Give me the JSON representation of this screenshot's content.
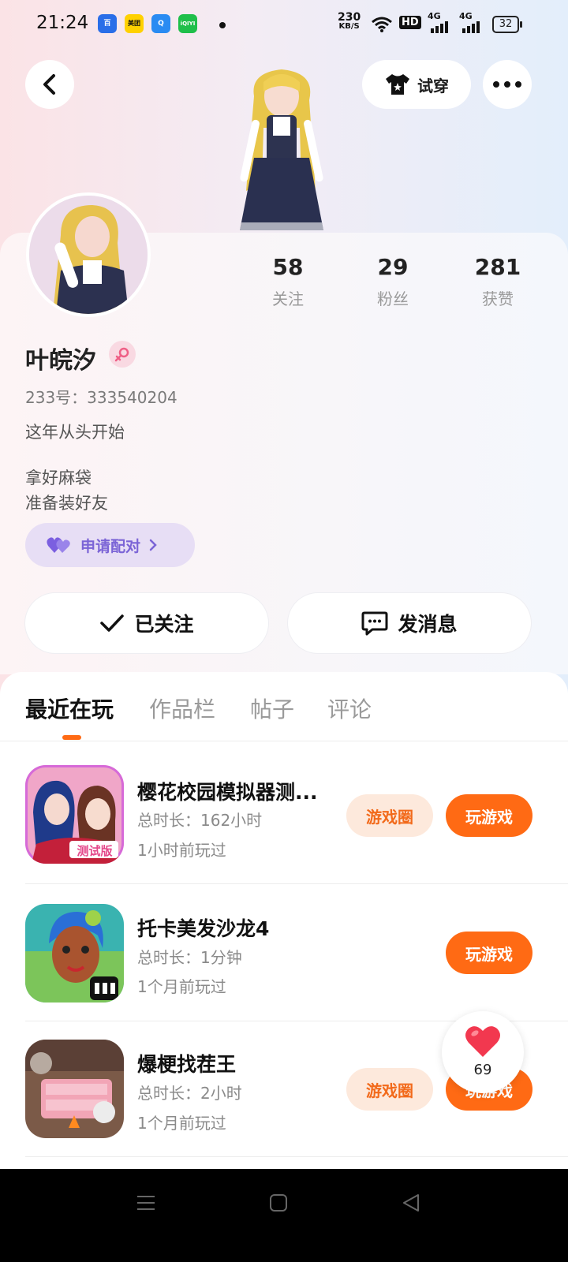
{
  "status_bar": {
    "time": "21:24",
    "apps": [
      "百",
      "美团",
      "Q",
      "iQIYI"
    ],
    "net_speed_value": "230",
    "net_speed_unit": "KB/S",
    "hd": "HD",
    "signal1": "4G",
    "signal2": "4G",
    "battery": "32"
  },
  "header": {
    "try_on_label": "试穿"
  },
  "profile": {
    "stats": [
      {
        "num": "58",
        "label": "关注"
      },
      {
        "num": "29",
        "label": "粉丝"
      },
      {
        "num": "281",
        "label": "获赞"
      }
    ],
    "name": "叶皖汐",
    "uid": "233号：333540204",
    "bio1": "这年从头开始",
    "bio2": "拿好麻袋",
    "bio3": "准备装好友",
    "pair_label": "申请配对"
  },
  "actions": {
    "followed_label": "已关注",
    "message_label": "发消息"
  },
  "tabs": [
    "最近在玩",
    "作品栏",
    "帖子",
    "评论"
  ],
  "games": [
    {
      "title": "樱花校园模拟器测...",
      "duration": "总时长：162小时",
      "last_played": "1小时前玩过",
      "circle": "游戏圈",
      "play": "玩游戏",
      "badge": "测试版"
    },
    {
      "title": "托卡美发沙龙4",
      "duration": "总时长：1分钟",
      "last_played": "1个月前玩过",
      "play": "玩游戏"
    },
    {
      "title": "爆梗找茬王",
      "duration": "总时长：2小时",
      "last_played": "1个月前玩过",
      "circle": "游戏圈",
      "play": "玩游戏"
    }
  ],
  "floating_like": {
    "count": "69"
  },
  "colors": {
    "accent": "#ff6a14",
    "pair_text": "#7b64d6",
    "heart": "#f2384f"
  }
}
